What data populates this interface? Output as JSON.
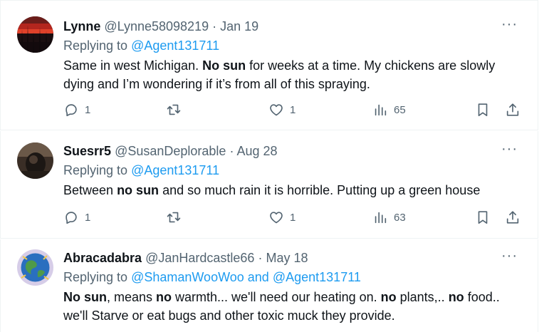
{
  "tweets": [
    {
      "name": "Lynne",
      "handle": "@Lynne58098219",
      "separator": "·",
      "date": "Jan 19",
      "replying_prefix": "Replying to",
      "mentions": [
        "@Agent131711"
      ],
      "mention_joiner": "",
      "text_segments": [
        {
          "t": "Same in west Michigan. "
        },
        {
          "t": "No sun",
          "b": true
        },
        {
          "t": " for weeks at a time. My chickens are slowly dying and I’m wondering if it’s from all of this spraying."
        }
      ],
      "replies": "1",
      "retweets": "",
      "likes": "1",
      "views": "65"
    },
    {
      "name": "Suesrr5",
      "handle": "@SusanDeplorable",
      "separator": "·",
      "date": "Aug 28",
      "replying_prefix": "Replying to",
      "mentions": [
        "@Agent131711"
      ],
      "mention_joiner": "",
      "text_segments": [
        {
          "t": "Between "
        },
        {
          "t": "no sun",
          "b": true
        },
        {
          "t": " and so much rain it is horrible.  Putting up a green house"
        }
      ],
      "replies": "1",
      "retweets": "",
      "likes": "1",
      "views": "63"
    },
    {
      "name": "Abracadabra",
      "handle": "@JanHardcastle66",
      "separator": "·",
      "date": "May 18",
      "replying_prefix": "Replying to",
      "mentions": [
        "@ShamanWooWoo",
        "@Agent131711"
      ],
      "mention_joiner": "and",
      "text_segments": [
        {
          "t": "No sun",
          "b": true
        },
        {
          "t": ", means "
        },
        {
          "t": "no",
          "b": true
        },
        {
          "t": " warmth... we'll need our heating on.  "
        },
        {
          "t": "no",
          "b": true
        },
        {
          "t": " plants,.. "
        },
        {
          "t": "no",
          "b": true
        },
        {
          "t": " food.. we'll Starve or eat bugs and other toxic muck they provide."
        }
      ]
    }
  ],
  "more_label": "···",
  "icons": {
    "reply": "reply-icon",
    "retweet": "retweet-icon",
    "like": "heart-icon",
    "views": "views-bar-chart-icon",
    "bookmark": "bookmark-icon",
    "share": "share-icon",
    "more": "more-dots-icon"
  },
  "colors": {
    "link": "#1d9bf0",
    "secondary_text": "#536471",
    "primary_text": "#0f1419",
    "divider": "#eff3f4"
  }
}
